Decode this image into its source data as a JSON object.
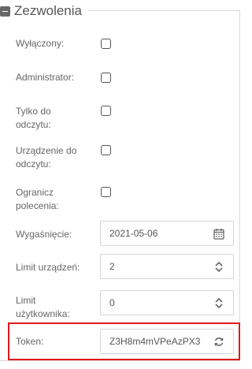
{
  "section": {
    "title": "Zezwolenia",
    "collapse_icon": "minus-square-icon"
  },
  "fields": {
    "disabled": {
      "label": "Wyłączony:",
      "checked": false
    },
    "admin": {
      "label": "Administrator:",
      "checked": false
    },
    "readonly": {
      "label": "Tylko do odczytu:",
      "checked": false
    },
    "device_readonly": {
      "label": "Urządzenie do odczytu:",
      "checked": false
    },
    "limit_commands": {
      "label": "Ogranicz polecenia:",
      "checked": false
    },
    "expiry": {
      "label": "Wygaśnięcie:",
      "value": "2021-05-06",
      "icon": "calendar-icon"
    },
    "device_limit": {
      "label": "Limit urządzeń:",
      "value": "2",
      "icon": "spinner-arrows-icon"
    },
    "user_limit": {
      "label": "Limit użytkownika:",
      "value": "0",
      "icon": "spinner-arrows-icon"
    },
    "token": {
      "label": "Token:",
      "value": "Z3H8m4mVPeAzPX3",
      "icon": "refresh-icon"
    }
  },
  "colors": {
    "highlight": "#e0191b",
    "border": "#d6d6d6",
    "text": "#666666"
  }
}
